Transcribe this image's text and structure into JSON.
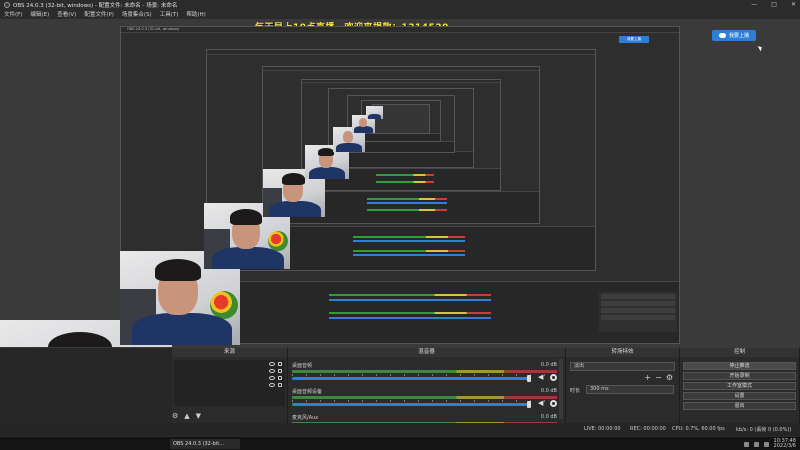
{
  "window": {
    "title": "OBS 24.0.3 (32-bit, windows) - 配置文件: 未命名 - 场景: 未命名",
    "controls": [
      "—",
      "□",
      "✕"
    ]
  },
  "menu": [
    "文件(F)",
    "编辑(E)",
    "查看(V)",
    "配置文件(P)",
    "场景集合(S)",
    "工具(T)",
    "帮助(H)"
  ],
  "overlay": {
    "text": "每天早上10点直播　欢迎来捐款：1314520"
  },
  "live_button": {
    "label": "我要上播"
  },
  "nested": {
    "title": "OBS 24.0.3 (32-bit, windows)",
    "live_label": "我要上播"
  },
  "panels": {
    "sources": {
      "header": "来源",
      "tools": [
        "⚙",
        "▲",
        "▼"
      ]
    },
    "mixer": {
      "header": "混音器",
      "channels": [
        {
          "name": "桌面音频",
          "db": "0.0 dB"
        },
        {
          "name": "桌面音频设备",
          "db": "0.0 dB"
        },
        {
          "name": "麦克风/Aux",
          "db": "0.0 dB"
        }
      ]
    },
    "transitions": {
      "header": "转场特效",
      "selected": "淡出",
      "tools": [
        "+",
        "−",
        "⚙"
      ],
      "duration_label": "时长",
      "duration_value": "300 ms"
    },
    "controls": {
      "header": "控制",
      "buttons": [
        "停止推流",
        "开始录制",
        "工作室模式",
        "设置",
        "退出"
      ]
    }
  },
  "status": {
    "live": "LIVE: 00:00:00",
    "rec": "REC: 00:00:00",
    "cpu": "CPU: 0.7%, 60.00 fps",
    "bitrate": "kb/s: 0 (丢帧 0 (0.0%))"
  },
  "taskbar": {
    "task_label": "OBS 24.0.3 (32-bit...",
    "time": "10:37:48",
    "date": "2022/3/6"
  }
}
